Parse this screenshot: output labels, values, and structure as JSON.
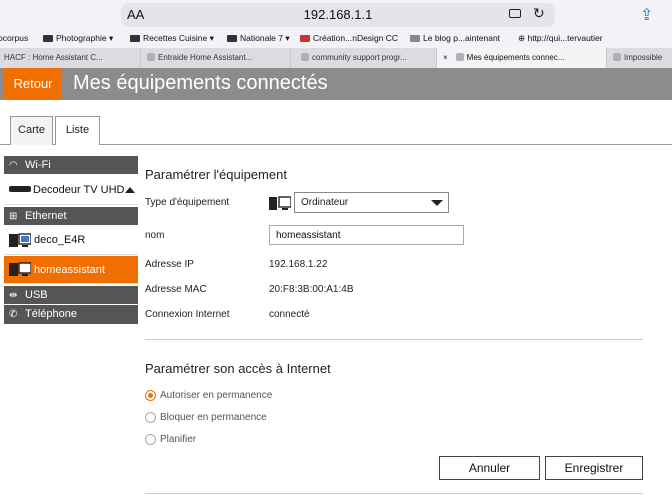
{
  "browser": {
    "aa_label": "AA",
    "url": "192.168.1.1",
    "bookmarks": [
      "ocorpus",
      "Photographie",
      "Recettes Cuisine",
      "Nationale 7",
      "Création...nDesign CC",
      "Le blog p...aintenant",
      "http://qui...tervautier"
    ],
    "tabs": [
      "HACF : Home Assistant C...",
      "Entraide Home Assistant...",
      "community support progr...",
      "Mes équipements connec...",
      "Impossible"
    ],
    "close_glyph": "×"
  },
  "header": {
    "back_label": "Retour",
    "title": "Mes équipements connectés"
  },
  "view_tabs": {
    "map": "Carte",
    "list": "Liste"
  },
  "sidebar": {
    "wifi_label": "Wi-Fi",
    "wifi_device": "Decodeur TV UHD",
    "ethernet_label": "Ethernet",
    "eth_devices": [
      "deco_E4R",
      "homeassistant"
    ],
    "usb_label": "USB",
    "phone_label": "Téléphone"
  },
  "device_form": {
    "title": "Paramétrer l'équipement",
    "type_label": "Type d'équipement",
    "type_value": "Ordinateur",
    "name_label": "nom",
    "name_value": "homeassistant",
    "ip_label": "Adresse IP",
    "ip_value": "192.168.1.22",
    "mac_label": "Adresse MAC",
    "mac_value": "20:F8:3B:00:A1:4B",
    "conn_label": "Connexion Internet",
    "conn_value": "connecté"
  },
  "access": {
    "title": "Paramétrer son accès à Internet",
    "options": [
      "Autoriser en permanence",
      "Bloquer en permanence",
      "Planifier"
    ]
  },
  "buttons": {
    "cancel": "Annuler",
    "save": "Enregistrer"
  },
  "colors": {
    "accent": "#f16e00",
    "header": "#8c8c8c",
    "section": "#555555"
  }
}
